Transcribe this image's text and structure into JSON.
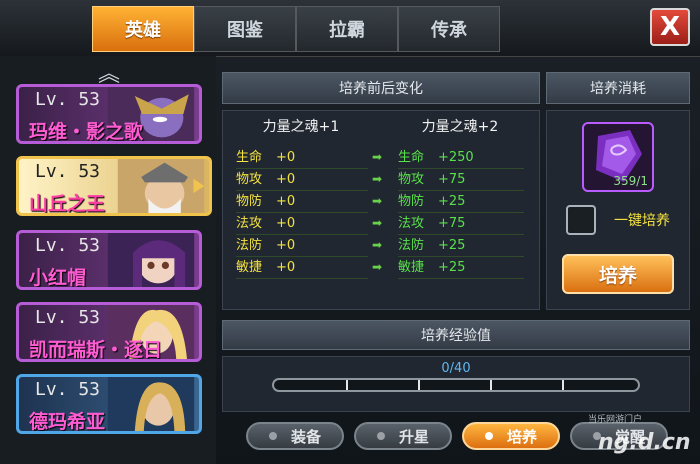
{
  "tabs": [
    "英雄",
    "图鉴",
    "拉霸",
    "传承"
  ],
  "close_label": "X",
  "heroes": [
    {
      "level": "Lv. 53",
      "name": "玛维・影之歌"
    },
    {
      "level": "Lv. 53",
      "name": "山丘之王"
    },
    {
      "level": "Lv. 53",
      "name": "小红帽"
    },
    {
      "level": "Lv. 53",
      "name": "凯而瑞斯・逐日"
    },
    {
      "level": "Lv. 53",
      "name": "德玛希亚"
    }
  ],
  "change_panel": {
    "title": "培养前后变化",
    "before_title": "力量之魂+1",
    "after_title": "力量之魂+2",
    "before": [
      {
        "label": "生命",
        "value": "+0"
      },
      {
        "label": "物攻",
        "value": "+0"
      },
      {
        "label": "物防",
        "value": "+0"
      },
      {
        "label": "法攻",
        "value": "+0"
      },
      {
        "label": "法防",
        "value": "+0"
      },
      {
        "label": "敏捷",
        "value": "+0"
      }
    ],
    "after": [
      {
        "label": "生命",
        "value": "+250"
      },
      {
        "label": "物攻",
        "value": "+75"
      },
      {
        "label": "物防",
        "value": "+25"
      },
      {
        "label": "法攻",
        "value": "+75"
      },
      {
        "label": "法防",
        "value": "+25"
      },
      {
        "label": "敏捷",
        "value": "+25"
      }
    ]
  },
  "cost_panel": {
    "title": "培养消耗",
    "item_count": "359/1",
    "auto_label": "一键培养",
    "train_button": "培养"
  },
  "exp_panel": {
    "title": "培养经验值",
    "progress_text": "0/40",
    "progress": 0
  },
  "bottom_buttons": [
    "装备",
    "升星",
    "培养",
    "觉醒"
  ],
  "watermark": {
    "line1": "当乐网游门户",
    "line2": "ng.d.cn"
  }
}
